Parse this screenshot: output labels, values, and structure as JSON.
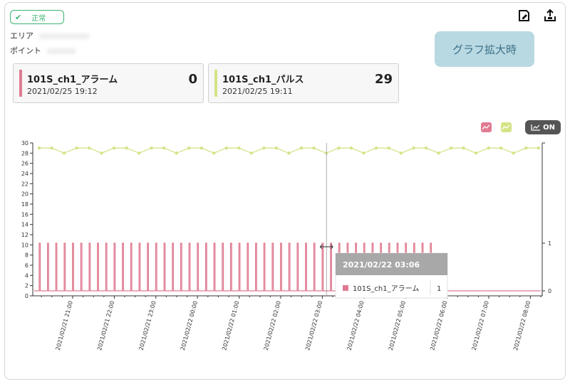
{
  "header": {
    "status": {
      "icon": "check-icon",
      "label": "正常",
      "color": "#3cb371"
    },
    "area_label": "エリア",
    "point_label": "ポイント",
    "actions": [
      {
        "name": "save-edit-icon"
      },
      {
        "name": "upload-icon"
      }
    ],
    "zoom_button": "グラフ拡大時"
  },
  "cards": [
    {
      "name": "101S_ch1_アラーム",
      "time": "2021/02/25 19:12",
      "value": "0",
      "color": "#e07b91"
    },
    {
      "name": "101S_ch1_パルス",
      "time": "2021/02/25 19:11",
      "value": "29",
      "color": "#d4e488"
    }
  ],
  "chart_controls": {
    "legend_icons": [
      {
        "name": "alarm-series-icon",
        "color": "#e07b91"
      },
      {
        "name": "pulse-series-icon",
        "color": "#d4e488"
      }
    ],
    "toggle_label": "ON"
  },
  "tooltip": {
    "title": "2021/02/22 03:06",
    "series": "101S_ch1_アラーム",
    "value": "1"
  },
  "chart_data": {
    "type": "line",
    "x_tick_labels": [
      "2021/02/21 21:00",
      "2021/02/21 22:00",
      "2021/02/21 23:00",
      "2021/02/22 00:00",
      "2021/02/22 01:00",
      "2021/02/22 02:00",
      "2021/02/22 03:00",
      "2021/02/22 04:00",
      "2021/02/22 05:00",
      "2021/02/22 06:00",
      "2021/02/22 07:00",
      "2021/02/22 08:00"
    ],
    "y_left": {
      "ylim": [
        0,
        30
      ],
      "ticks": [
        0,
        2,
        4,
        6,
        8,
        10,
        12,
        14,
        16,
        18,
        20,
        22,
        24,
        26,
        28,
        30
      ]
    },
    "y_right": {
      "ylim": [
        0,
        1
      ],
      "ticks": [
        0,
        1
      ]
    },
    "series": [
      {
        "name": "101S_ch1_パルス",
        "color": "#d4e488",
        "axis": "left",
        "x_start": "2021/02/21 20:18",
        "interval_min": 18,
        "values": [
          29,
          29,
          28,
          29,
          29,
          28,
          29,
          29,
          28,
          29,
          29,
          28,
          29,
          29,
          28,
          29,
          29,
          28,
          29,
          29,
          28,
          29,
          29,
          28,
          29,
          29,
          28,
          29,
          29,
          28,
          29,
          29,
          28,
          29,
          29,
          28,
          29,
          29,
          28,
          29,
          29,
          28,
          29,
          29,
          28,
          29,
          29,
          28,
          29
        ]
      },
      {
        "name": "101S_ch1_アラーム",
        "color": "#e07b91",
        "axis": "right",
        "x_start": "2021/02/21 20:18",
        "interval_min": 12,
        "pattern": "pulse 1 then 0",
        "pulse_count": 48
      }
    ]
  }
}
